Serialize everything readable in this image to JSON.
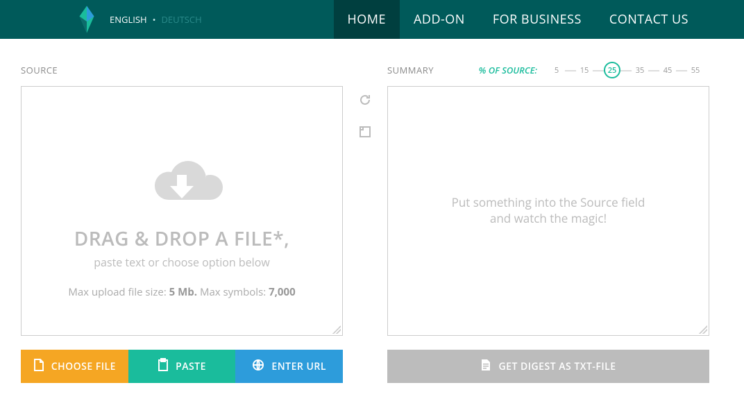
{
  "header": {
    "lang": {
      "en": "ENGLISH",
      "de": "DEUTSCH"
    },
    "nav": {
      "home": "HOME",
      "addon": "ADD-ON",
      "business": "FOR BUSINESS",
      "contact": "CONTACT US"
    }
  },
  "source": {
    "label": "SOURCE",
    "drop_title": "DRAG & DROP A FILE*,",
    "drop_sub": "paste text or choose option below",
    "limits_prefix": "Max upload file size: ",
    "limits_size": "5 Mb.",
    "limits_mid": " Max symbols: ",
    "limits_symbols": "7,000",
    "buttons": {
      "choose": "CHOOSE FILE",
      "paste": "PASTE",
      "url": "ENTER URL"
    }
  },
  "summary": {
    "label": "SUMMARY",
    "percent_label": "% OF SOURCE:",
    "slider_values": {
      "v0": "5",
      "v1": "15",
      "v2": "25",
      "v3": "35",
      "v4": "45",
      "v5": "55"
    },
    "selected": "25",
    "placeholder_line1": "Put something into the Source field",
    "placeholder_line2": "and watch the magic!",
    "download_btn": "GET DIGEST AS TXT-FILE"
  }
}
